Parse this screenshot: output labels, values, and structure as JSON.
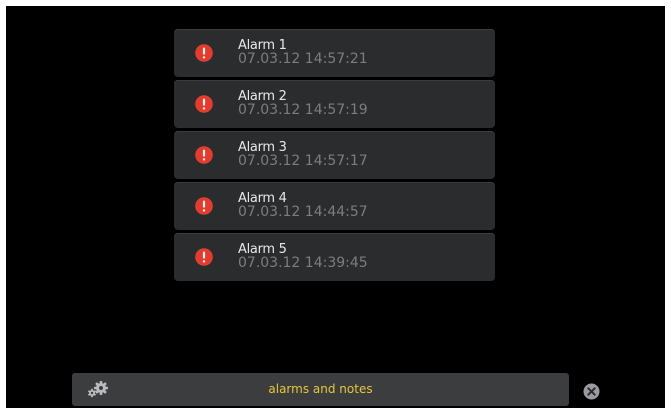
{
  "header": {
    "title": "alarms and notes"
  },
  "alarms": [
    {
      "title": "Alarm 1",
      "timestamp": "07.03.12 14:57:21"
    },
    {
      "title": "Alarm 2",
      "timestamp": "07.03.12 14:57:19"
    },
    {
      "title": "Alarm 3",
      "timestamp": "07.03.12 14:57:17"
    },
    {
      "title": "Alarm 4",
      "timestamp": "07.03.12 14:44:57"
    },
    {
      "title": "Alarm 5",
      "timestamp": "07.03.12 14:39:45"
    }
  ],
  "icons": {
    "alarm": "alert-icon",
    "settings": "gear-icon",
    "close": "close-icon"
  },
  "colors": {
    "background": "#000000",
    "item_background": "#2a2c2e",
    "alert_red": "#e8392a",
    "title_accent": "#e8c53a",
    "timestamp_gray": "#7b7d80"
  }
}
